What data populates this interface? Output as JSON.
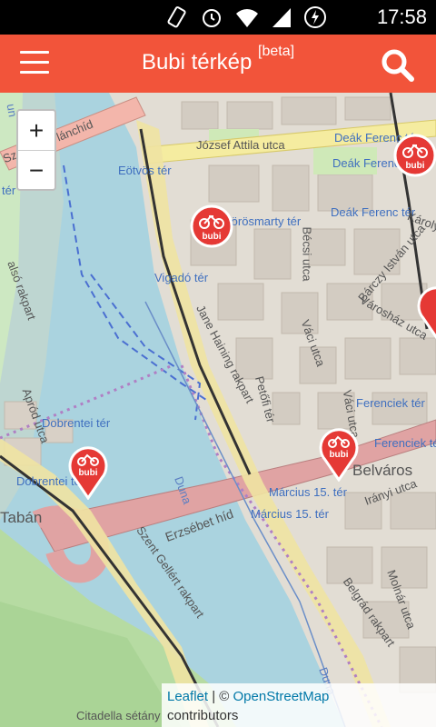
{
  "status_bar": {
    "time": "17:58"
  },
  "app_bar": {
    "title": "Bubi térkép",
    "badge": "[beta]"
  },
  "map": {
    "zoom_in": "+",
    "zoom_out": "−",
    "marker_label": "bubi",
    "street_labels": {
      "jozsef_attila": "József Attila utca",
      "deak_ferenc_ter_1": "Deák Ferenc tér",
      "deak_ferenc_ter_2": "Deák Ferenc tér",
      "deak_ferenc_ter_3": "Deák Ferenc tér",
      "eotvos_ter": "Eötvös tér",
      "vorosmarty_ter": "Vörösmarty tér",
      "vigado_ter": "Vigadó tér",
      "becsi_utca": "Bécsi utca",
      "karoly": "Károly",
      "barczy": "Bárczy István utca",
      "varoshaz": "Városház utca",
      "vaci_utca_1": "Váci utca",
      "vaci_utca_2": "Váci utca",
      "jane_haining": "Jane Haining rakpart",
      "petofi": "Petőfi tér",
      "ferenciek_ter_1": "Ferenciek tér",
      "ferenciek_ter_2": "Ferenciek tér",
      "belvaros": "Belváros",
      "marcius_1": "Március 15. tér",
      "marcius_2": "Március 15. tér",
      "iranyi": "Irányi utca",
      "erzsebet_hid": "Erzsébet híd",
      "duna_1": "Duna",
      "duna_2": "Duna",
      "alsó_rakpart": "alsó rakpart",
      "apród": "Apród utca",
      "dobrentei_1": "Dobrentei tér",
      "dobrentei_2": "Dobrentei tér",
      "taban": "Tabán",
      "szent_gellert": "Szent Gellért rakpart",
      "molnar": "Molnár utca",
      "belgrad": "Belgrád rakpart",
      "citadella": "Citadella sétány",
      "szechenyi": "Széchenyi lánchíd",
      "ter": "tér",
      "un": "un"
    }
  },
  "attribution": {
    "leaflet": "Leaflet",
    "separator": " | © ",
    "osm": "OpenStreetMap",
    "contributors": "contributors"
  }
}
